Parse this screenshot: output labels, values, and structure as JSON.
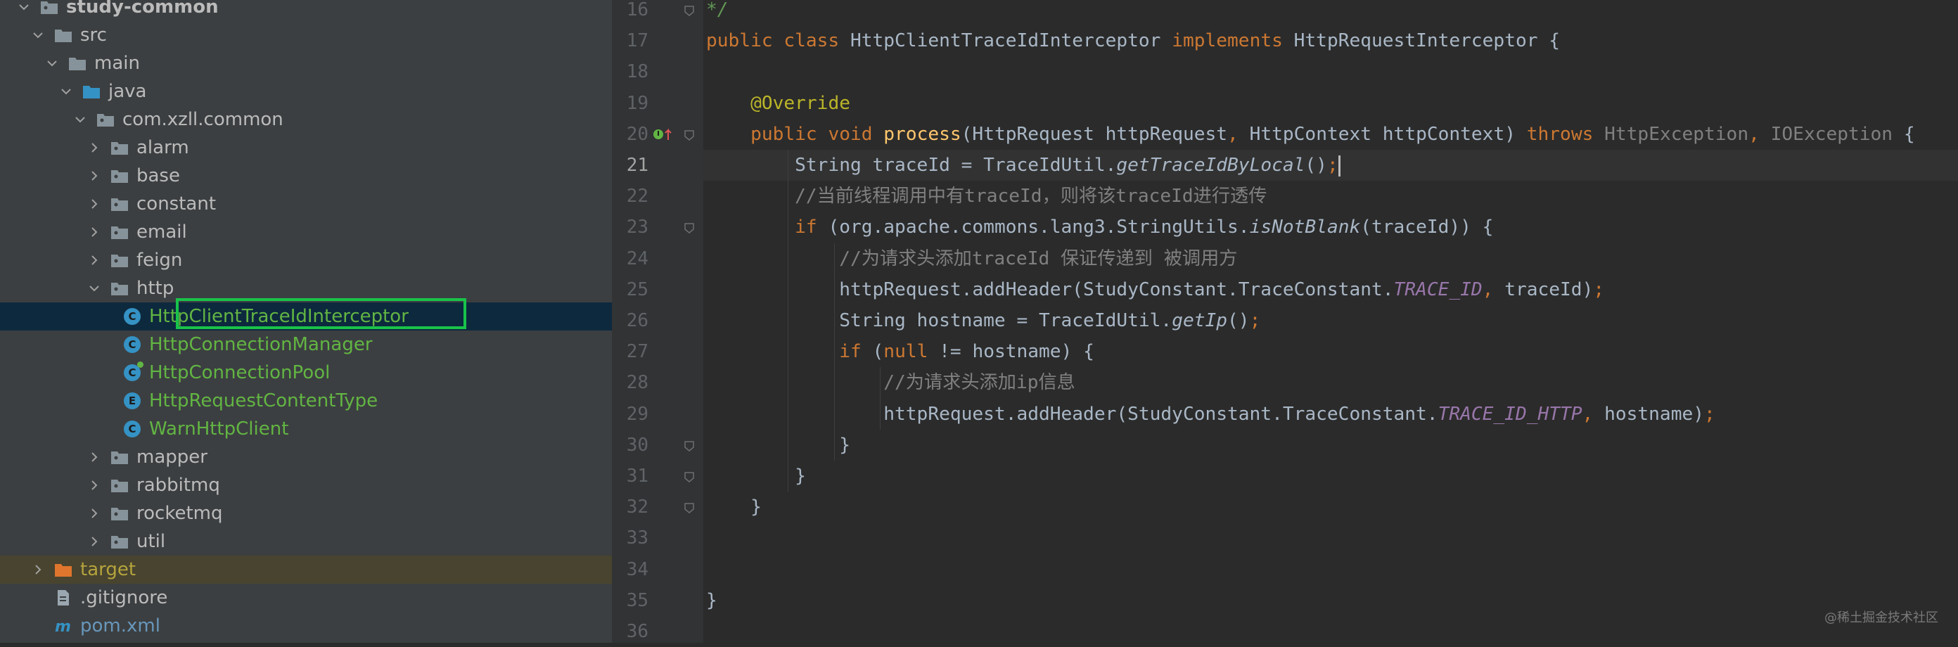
{
  "project_tree": {
    "items": [
      {
        "label": "study-common",
        "kind": "module",
        "expanded": true,
        "style": "bold"
      },
      {
        "label": "src",
        "kind": "folder",
        "expanded": true
      },
      {
        "label": "main",
        "kind": "folder",
        "expanded": true
      },
      {
        "label": "java",
        "kind": "source-folder",
        "expanded": true
      },
      {
        "label": "com.xzll.common",
        "kind": "package",
        "expanded": true
      },
      {
        "label": "alarm",
        "kind": "package",
        "expanded": false
      },
      {
        "label": "base",
        "kind": "package",
        "expanded": false
      },
      {
        "label": "constant",
        "kind": "package",
        "expanded": false
      },
      {
        "label": "email",
        "kind": "package",
        "expanded": false
      },
      {
        "label": "feign",
        "kind": "package",
        "expanded": false
      },
      {
        "label": "http",
        "kind": "package",
        "expanded": true
      },
      {
        "label": "HttpClientTraceIdInterceptor",
        "kind": "class",
        "icon_letter": "C",
        "selected": true
      },
      {
        "label": "HttpConnectionManager",
        "kind": "class",
        "icon_letter": "C"
      },
      {
        "label": "HttpConnectionPool",
        "kind": "class",
        "icon_letter": "C"
      },
      {
        "label": "HttpRequestContentType",
        "kind": "enum",
        "icon_letter": "E"
      },
      {
        "label": "WarnHttpClient",
        "kind": "class",
        "icon_letter": "C"
      },
      {
        "label": "mapper",
        "kind": "package",
        "expanded": false
      },
      {
        "label": "rabbitmq",
        "kind": "package",
        "expanded": false
      },
      {
        "label": "rocketmq",
        "kind": "package",
        "expanded": false
      },
      {
        "label": "util",
        "kind": "package",
        "expanded": false
      },
      {
        "label": "target",
        "kind": "excluded-folder",
        "expanded": false
      },
      {
        "label": ".gitignore",
        "kind": "file"
      },
      {
        "label": "pom.xml",
        "kind": "maven-file"
      }
    ]
  },
  "editor": {
    "current_line": "21",
    "lines": [
      {
        "n": "16",
        "tokens": [
          {
            "t": "*/",
            "c": "doc"
          }
        ]
      },
      {
        "n": "17",
        "tokens": [
          {
            "t": "public class ",
            "c": "kw"
          },
          {
            "t": "HttpClientTraceIdInterceptor "
          },
          {
            "t": "implements ",
            "c": "kw"
          },
          {
            "t": "HttpRequestInterceptor {"
          }
        ]
      },
      {
        "n": "18",
        "tokens": []
      },
      {
        "n": "19",
        "tokens": [
          {
            "t": "    "
          },
          {
            "t": "@Override",
            "c": "ann"
          }
        ]
      },
      {
        "n": "20",
        "tokens": [
          {
            "t": "    "
          },
          {
            "t": "public void ",
            "c": "kw"
          },
          {
            "t": "process",
            "c": "fn"
          },
          {
            "t": "(HttpRequest httpRequest"
          },
          {
            "t": ", ",
            "c": "kw"
          },
          {
            "t": "HttpContext httpContext) "
          },
          {
            "t": "throws ",
            "c": "kw"
          },
          {
            "t": "HttpException",
            "c": "gray"
          },
          {
            "t": ", ",
            "c": "kw"
          },
          {
            "t": "IOException",
            "c": "gray"
          },
          {
            "t": " {"
          }
        ]
      },
      {
        "n": "21",
        "tokens": [
          {
            "t": "        String traceId = TraceIdUtil."
          },
          {
            "t": "getTraceIdByLocal",
            "c": "st"
          },
          {
            "t": "()"
          },
          {
            "t": ";",
            "c": "kw"
          }
        ],
        "caret": true
      },
      {
        "n": "22",
        "tokens": [
          {
            "t": "        "
          },
          {
            "t": "//当前线程调用中有traceId，则将该traceId进行透传",
            "c": "cm"
          }
        ]
      },
      {
        "n": "23",
        "tokens": [
          {
            "t": "        "
          },
          {
            "t": "if ",
            "c": "kw"
          },
          {
            "t": "(org.apache.commons.lang3.StringUtils."
          },
          {
            "t": "isNotBlank",
            "c": "st"
          },
          {
            "t": "(traceId)) {"
          }
        ]
      },
      {
        "n": "24",
        "tokens": [
          {
            "t": "            "
          },
          {
            "t": "//为请求头添加traceId 保证传递到 被调用方",
            "c": "cm"
          }
        ]
      },
      {
        "n": "25",
        "tokens": [
          {
            "t": "            httpRequest.addHeader(StudyConstant.TraceConstant."
          },
          {
            "t": "TRACE_ID",
            "c": "cst"
          },
          {
            "t": ", ",
            "c": "kw"
          },
          {
            "t": "traceId)"
          },
          {
            "t": ";",
            "c": "kw"
          }
        ]
      },
      {
        "n": "26",
        "tokens": [
          {
            "t": "            String hostname = TraceIdUtil."
          },
          {
            "t": "getIp",
            "c": "st"
          },
          {
            "t": "()"
          },
          {
            "t": ";",
            "c": "kw"
          }
        ]
      },
      {
        "n": "27",
        "tokens": [
          {
            "t": "            "
          },
          {
            "t": "if ",
            "c": "kw"
          },
          {
            "t": "("
          },
          {
            "t": "null ",
            "c": "kw"
          },
          {
            "t": "!= hostname) {"
          }
        ]
      },
      {
        "n": "28",
        "tokens": [
          {
            "t": "                "
          },
          {
            "t": "//为请求头添加ip信息",
            "c": "cm"
          }
        ]
      },
      {
        "n": "29",
        "tokens": [
          {
            "t": "                httpRequest.addHeader(StudyConstant.TraceConstant."
          },
          {
            "t": "TRACE_ID_HTTP",
            "c": "cst"
          },
          {
            "t": ", ",
            "c": "kw"
          },
          {
            "t": "hostname)"
          },
          {
            "t": ";",
            "c": "kw"
          }
        ]
      },
      {
        "n": "30",
        "tokens": [
          {
            "t": "            }"
          }
        ]
      },
      {
        "n": "31",
        "tokens": [
          {
            "t": "        }"
          }
        ]
      },
      {
        "n": "32",
        "tokens": [
          {
            "t": "    }"
          }
        ]
      },
      {
        "n": "33",
        "tokens": []
      },
      {
        "n": "34",
        "tokens": []
      },
      {
        "n": "35",
        "tokens": [
          {
            "t": "}"
          }
        ]
      },
      {
        "n": "36",
        "tokens": []
      }
    ]
  },
  "watermark": "@稀土掘金技术社区",
  "colors": {
    "tree_bg": "#3c3f41",
    "editor_bg": "#2b2b2b",
    "selection": "#0d293e",
    "highlight_box": "#18c34a",
    "keyword": "#cc7832",
    "annotation": "#bbb529",
    "method": "#ffc66d",
    "constant": "#9876aa",
    "comment": "#808080"
  }
}
